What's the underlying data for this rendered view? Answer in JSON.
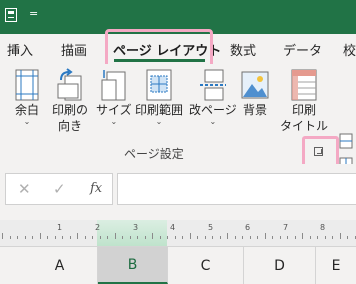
{
  "title_bar": {
    "save_icon": "save-icon",
    "qat_more": "="
  },
  "ribbon_tabs": [
    {
      "label": "挿入"
    },
    {
      "label": "描画"
    },
    {
      "label": "ページ レイアウト",
      "active": true
    },
    {
      "label": "数式"
    },
    {
      "label": "データ"
    },
    {
      "label": "校"
    }
  ],
  "ribbon_buttons": {
    "margins": {
      "label": "余白",
      "icon": "margins-icon"
    },
    "orientation": {
      "label1": "印刷の",
      "label2": "向き",
      "icon": "orientation-icon"
    },
    "size": {
      "label": "サイズ",
      "icon": "size-icon"
    },
    "print_area": {
      "label": "印刷範囲",
      "icon": "print-area-icon"
    },
    "breaks": {
      "label": "改ページ",
      "icon": "breaks-icon"
    },
    "background": {
      "label": "背景",
      "icon": "background-icon"
    },
    "print_titles": {
      "label1": "印刷",
      "label2": "タイトル",
      "icon": "print-titles-icon"
    }
  },
  "group": {
    "label": "ページ設定",
    "launcher_icon": "dialog-launcher-icon"
  },
  "formula_bar": {
    "cancel": "✕",
    "enter": "✓",
    "fx": "fx",
    "value": ""
  },
  "ruler": {
    "numbers": [
      "1",
      "2",
      "3",
      "4",
      "5",
      "6",
      "7",
      "8"
    ]
  },
  "columns": [
    {
      "label": "A",
      "selected": false
    },
    {
      "label": "B",
      "selected": true
    },
    {
      "label": "C",
      "selected": false
    },
    {
      "label": "D",
      "selected": false
    },
    {
      "label": "E",
      "selected": false
    }
  ],
  "colors": {
    "accent": "#217346",
    "highlight": "#f4a9c4"
  }
}
